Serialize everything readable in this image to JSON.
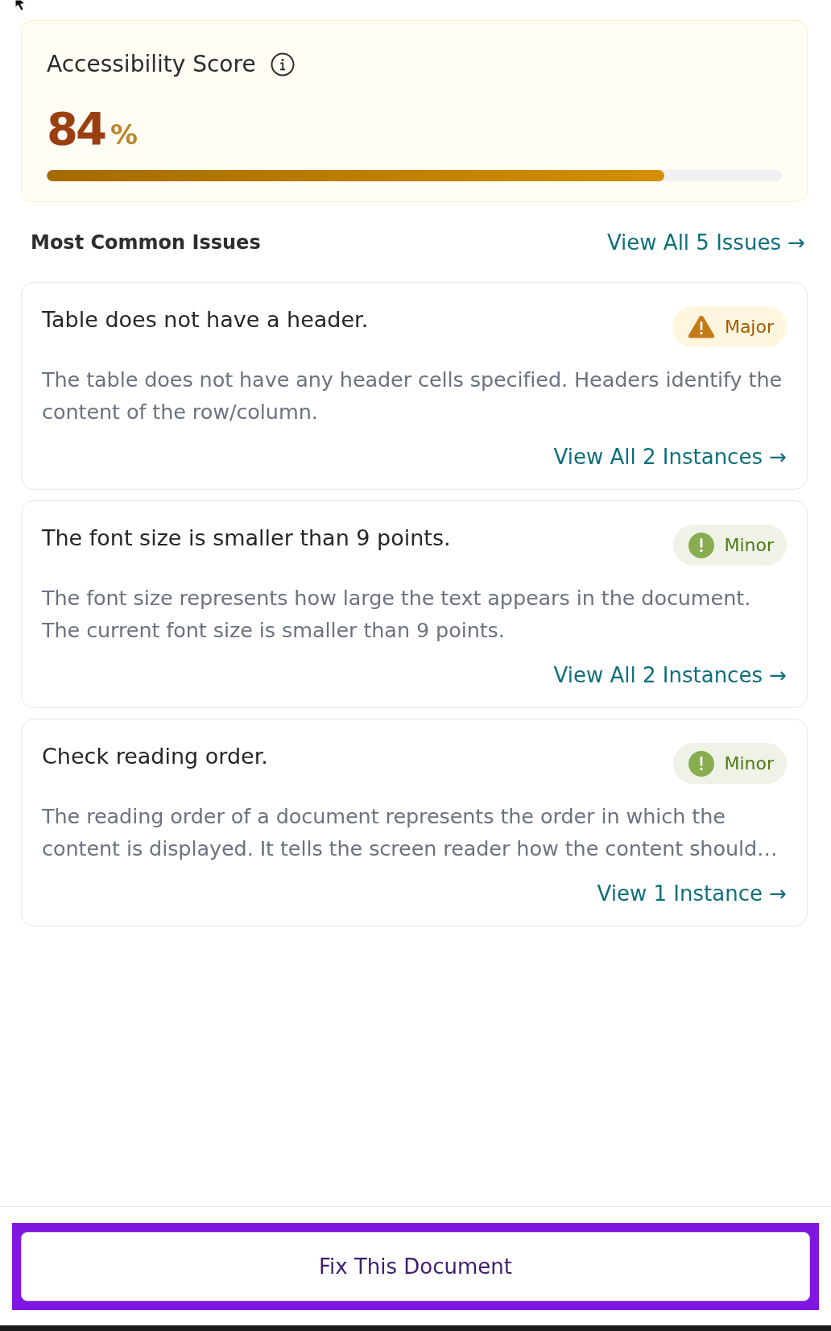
{
  "score_card": {
    "title": "Accessibility Score",
    "value": "84",
    "unit": "%",
    "level": 0.84
  },
  "issues_header": {
    "title": "Most Common Issues",
    "link": "View All 5 Issues →"
  },
  "issues": [
    {
      "title": "Table does not have a header.",
      "severity": {
        "kind": "major",
        "label": "Major"
      },
      "description": "The table does not have any header cells specified. Headers identify the content of the row/column.",
      "link": "View All 2 Instances →"
    },
    {
      "title": "The font size is smaller than 9 points.",
      "severity": {
        "kind": "minor",
        "label": "Minor"
      },
      "description": "The font size represents how large the text appears in the document. The current font size is smaller than 9 points.",
      "link": "View All 2 Instances →"
    },
    {
      "title": "Check reading order.",
      "severity": {
        "kind": "minor",
        "label": "Minor"
      },
      "description": "The reading order of a document represents the order in which the content is displayed. It tells the screen reader how the content should…",
      "link": "View 1 Instance →"
    }
  ],
  "footer": {
    "button": {
      "label": "Fix This Document",
      "focused": true
    }
  }
}
